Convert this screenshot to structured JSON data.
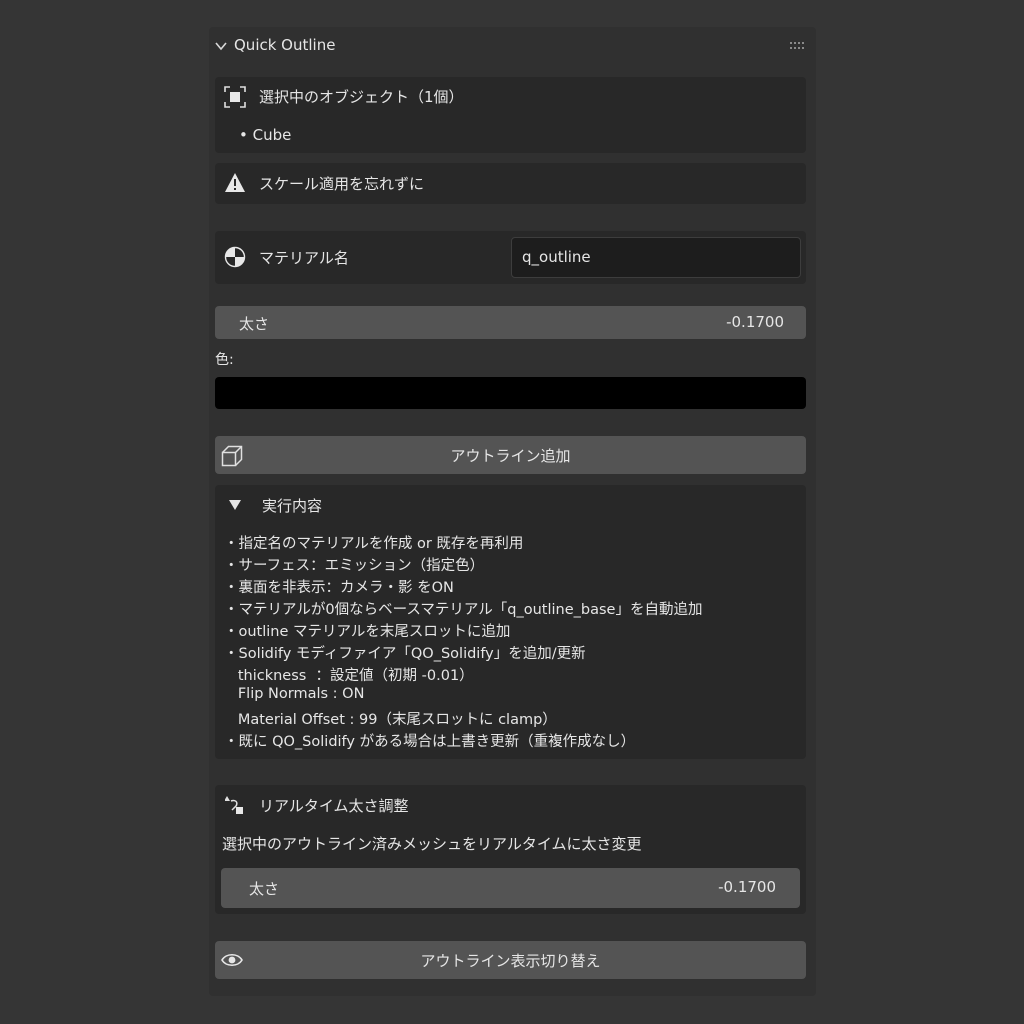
{
  "panel": {
    "title": "Quick Outline"
  },
  "selection": {
    "header": "選択中のオブジェクト（1個）",
    "items": [
      "• Cube"
    ]
  },
  "warning": {
    "text": "スケール適用を忘れずに"
  },
  "material": {
    "label": "マテリアル名",
    "value": "q_outline"
  },
  "thickness": {
    "label": "太さ",
    "value": "-0.1700"
  },
  "color": {
    "label": "色:",
    "swatch": "#000000"
  },
  "add_button": {
    "label": "アウトライン追加"
  },
  "details": {
    "header": "実行内容",
    "lines": [
      "・指定名のマテリアルを作成 or 既存を再利用",
      "・サーフェス：エミッション（指定色）",
      "・裏面を非表示：カメラ・影 をON",
      "・マテリアルが0個ならベースマテリアル「q_outline_base」を自動追加",
      "・outline マテリアルを末尾スロットに追加",
      "・Solidify モディファイア「QO_Solidify」を追加/更新",
      "   thickness  ：設定値（初期 -0.01）",
      "   Flip Normals : ON",
      "   Material Offset : 99（末尾スロットに clamp）",
      "・既に QO_Solidify がある場合は上書き更新（重複作成なし）"
    ]
  },
  "realtime": {
    "header": "リアルタイム太さ調整",
    "description": "選択中のアウトライン済みメッシュをリアルタイムに太さ変更",
    "slider_label": "太さ",
    "slider_value": "-0.1700"
  },
  "toggle_button": {
    "label": "アウトライン表示切り替え"
  }
}
